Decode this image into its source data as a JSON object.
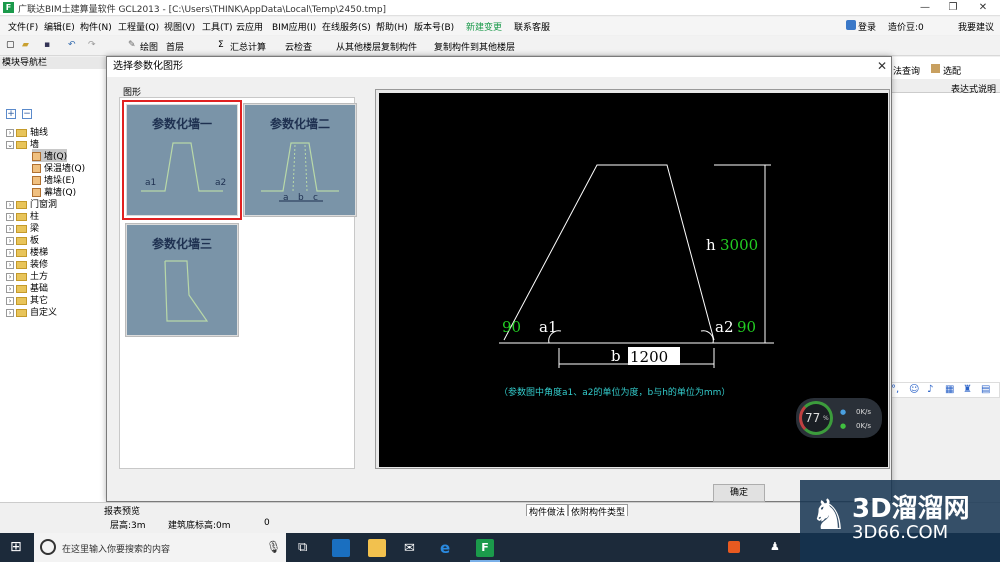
{
  "window": {
    "title": "广联达BIM土建算量软件 GCL2013 - [C:\\Users\\THINK\\AppData\\Local\\Temp\\2450.tmp]",
    "logo_text": "F"
  },
  "menu": [
    "文件(F)",
    "编辑(E)",
    "构件(N)",
    "工程量(Q)",
    "视图(V)",
    "工具(T)",
    "云应用",
    "BIM应用(I)",
    "在线服务(S)",
    "帮助(H)",
    "版本号(B)",
    "新建变更",
    "联系客服"
  ],
  "account": {
    "login": "登录",
    "coin": "造价豆:0",
    "suggest": "我要建议"
  },
  "toolbar": {
    "draw": "绘图",
    "floor": "首层",
    "sum": "汇总计算",
    "cloud_check": "云检查",
    "copy_from": "从其他楼层复制构件",
    "copy_to": "复制构件到其他楼层",
    "query": "法查询",
    "select": "选配"
  },
  "nav": {
    "title": "模块导航栏",
    "items": [
      {
        "label": "轴线",
        "level": 0,
        "expanded": false
      },
      {
        "label": "墙",
        "level": 0,
        "expanded": true
      },
      {
        "label": "墙(Q)",
        "level": 1,
        "selected": true
      },
      {
        "label": "保温墙(Q)",
        "level": 1
      },
      {
        "label": "墙垛(E)",
        "level": 1
      },
      {
        "label": "幕墙(Q)",
        "level": 1
      },
      {
        "label": "门窗洞",
        "level": 0
      },
      {
        "label": "柱",
        "level": 0
      },
      {
        "label": "梁",
        "level": 0
      },
      {
        "label": "板",
        "level": 0
      },
      {
        "label": "楼梯",
        "level": 0
      },
      {
        "label": "装修",
        "level": 0
      },
      {
        "label": "土方",
        "level": 0
      },
      {
        "label": "基础",
        "level": 0
      },
      {
        "label": "其它",
        "level": 0
      },
      {
        "label": "自定义",
        "level": 0
      }
    ]
  },
  "right_panel": {
    "header": "表达式说明"
  },
  "dialog": {
    "title": "选择参数化图形",
    "group_label": "图形",
    "shapes": [
      {
        "title": "参数化墙一",
        "selected": true,
        "labels": [
          "a1",
          "a2"
        ]
      },
      {
        "title": "参数化墙二",
        "selected": false,
        "labels": [
          "a",
          "b",
          "c"
        ]
      },
      {
        "title": "参数化墙三",
        "selected": false,
        "labels": []
      }
    ],
    "preview": {
      "h_label": "h",
      "h_value": "3000",
      "b_label": "b",
      "b_value": "1200",
      "a1_label": "a1",
      "a1_value": "90",
      "a2_label": "a2",
      "a2_value": "90",
      "note": "（参数图中角度a1、a2的单位为度，b与h的单位为mm）"
    },
    "ok_label": "确定"
  },
  "status": {
    "report": "报表预览",
    "floor_height": "层高:3m",
    "base_height": "建筑底标高:0m",
    "zero": "0",
    "tabs": [
      "构件做法",
      "依附构件类型"
    ]
  },
  "widget": {
    "percent": "77",
    "unit": "%",
    "up": "0K/s",
    "down": "0K/s"
  },
  "ime": {
    "lang": "中"
  },
  "taskbar": {
    "search_placeholder": "在这里输入你要搜索的内容"
  },
  "watermark": {
    "big": "3D溜溜网",
    "small": "3D66.COM"
  },
  "colors": {
    "green": "#1b9a4b",
    "value_green": "#22cc22",
    "cyan": "#33cccc",
    "selected_red": "#e02020"
  }
}
